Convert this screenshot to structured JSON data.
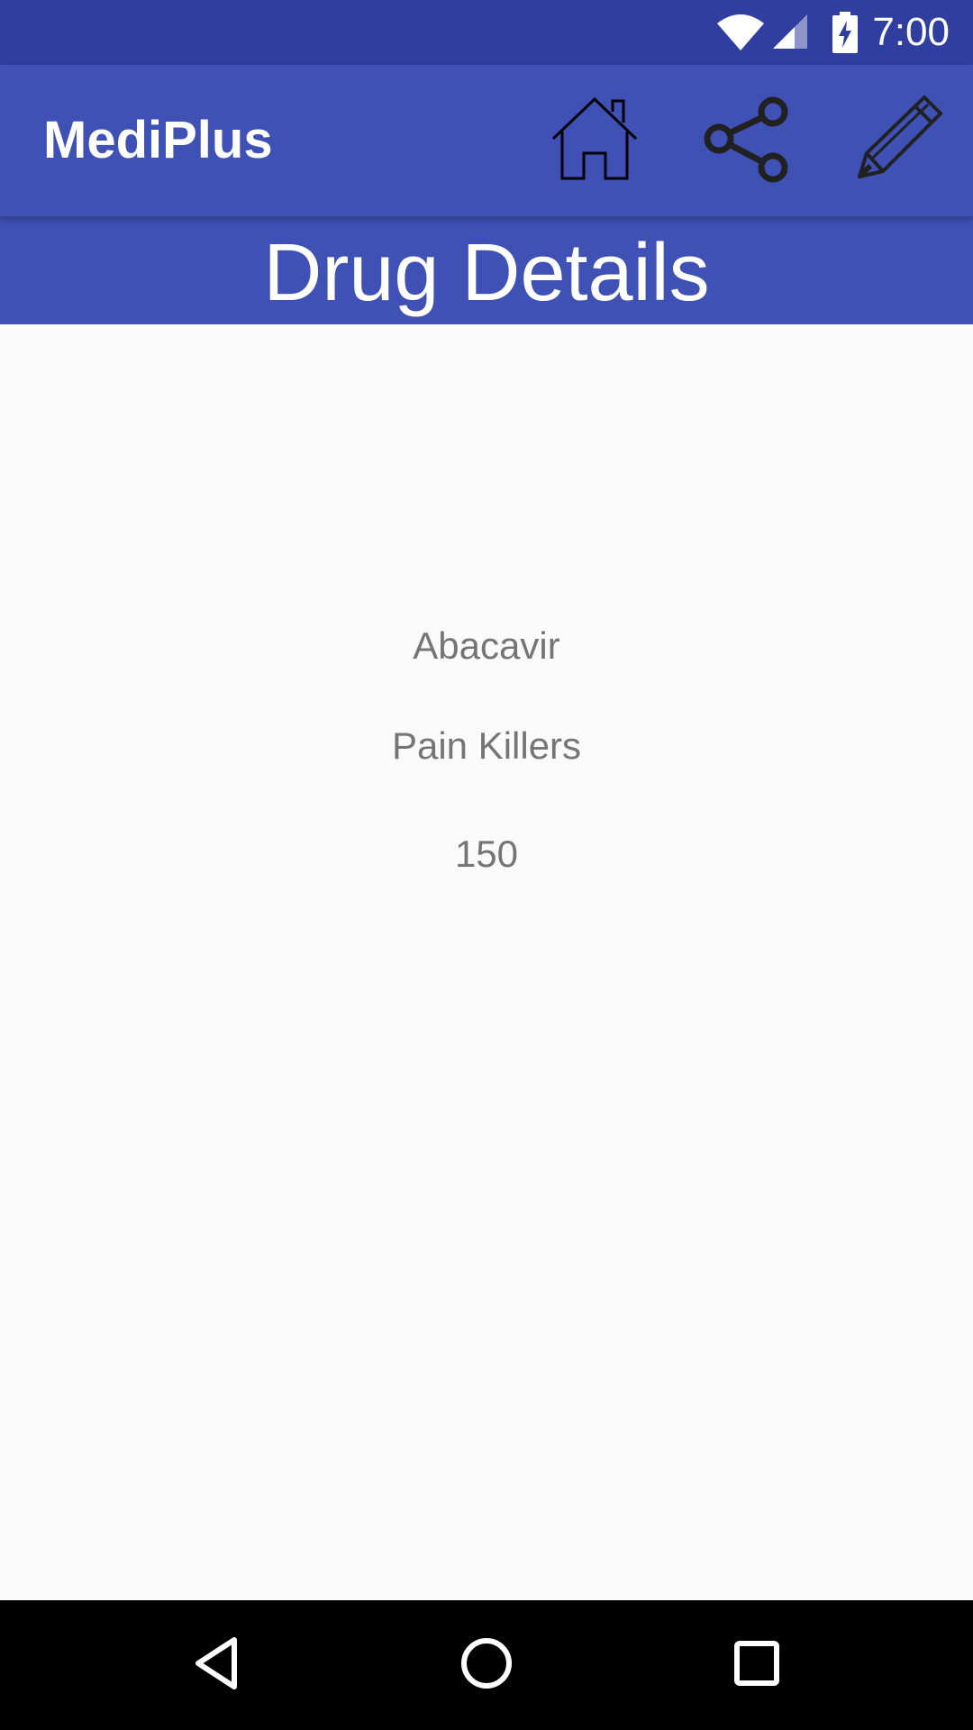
{
  "status_bar": {
    "time": "7:00",
    "icons": [
      "wifi-icon",
      "cell-signal-icon",
      "battery-charging-icon"
    ]
  },
  "app_bar": {
    "title": "MediPlus",
    "actions": [
      {
        "name": "home-icon"
      },
      {
        "name": "share-icon"
      },
      {
        "name": "pencil-icon"
      }
    ],
    "color": "#3f51b5"
  },
  "header": {
    "title": "Drug Details"
  },
  "drug": {
    "name": "Abacavir",
    "category": "Pain Killers",
    "price": "150"
  },
  "nav_bar": {
    "buttons": [
      "back-icon",
      "home-circle-icon",
      "recents-square-icon"
    ]
  },
  "colors": {
    "primary": "#3f51b5",
    "primary_dark": "#303f9f",
    "background": "#fafafa",
    "text_secondary": "#757575"
  }
}
